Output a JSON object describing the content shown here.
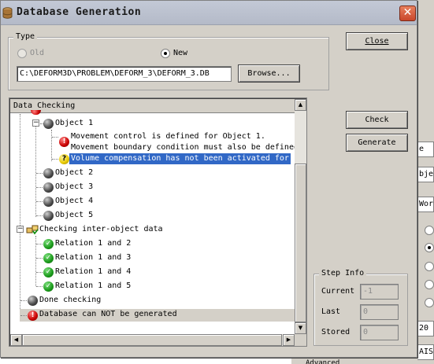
{
  "window": {
    "title": "Database Generation",
    "close_glyph": "✕"
  },
  "type_group": {
    "label": "Type",
    "options": [
      {
        "label": "Old",
        "checked": false,
        "disabled": true
      },
      {
        "label": "New",
        "checked": true,
        "disabled": false
      }
    ],
    "path_value": "C:\\DEFORM3D\\PROBLEM\\DEFORM_3\\DEFORM_3.DB",
    "browse_label": "Browse..."
  },
  "buttons": {
    "close": "Close",
    "check": "Check",
    "generate": "Generate"
  },
  "data_checking": {
    "header": "Data Checking",
    "nodes": {
      "object1": "Object 1",
      "msg1": "Movement control is defined for Object 1.",
      "msg2": "Movement boundary condition must also be defined",
      "msg3": "Volume compensation has not been activated for",
      "object2": "Object 2",
      "object3": "Object 3",
      "object4": "Object 4",
      "object5": "Object 5",
      "inter": "Checking inter-object data",
      "rel12": "Relation 1 and 2",
      "rel13": "Relation 1 and 3",
      "rel14": "Relation 1 and 4",
      "rel15": "Relation 1 and 5",
      "done": "Done checking",
      "result": "Database can NOT be generated"
    },
    "icons": {
      "sphere": "object-sphere-icon",
      "error": "error-icon",
      "warning": "warning-question-icon",
      "ok": "checkmark-icon",
      "inter": "inter-object-check-icon"
    }
  },
  "step_info": {
    "label": "Step Info",
    "current_label": "Current",
    "current_value": "-1",
    "last_label": "Last",
    "last_value": "0",
    "stored_label": "Stored",
    "stored_value": "0"
  },
  "background_app": {
    "strip_texts": [
      "e",
      "bjec",
      "Wor",
      "20",
      "AIS"
    ],
    "bottom_text": "Advanced"
  },
  "colors": {
    "selection": "#3168c6",
    "dialog_bg": "#d4d0c8",
    "close_button": "#c9462a"
  }
}
